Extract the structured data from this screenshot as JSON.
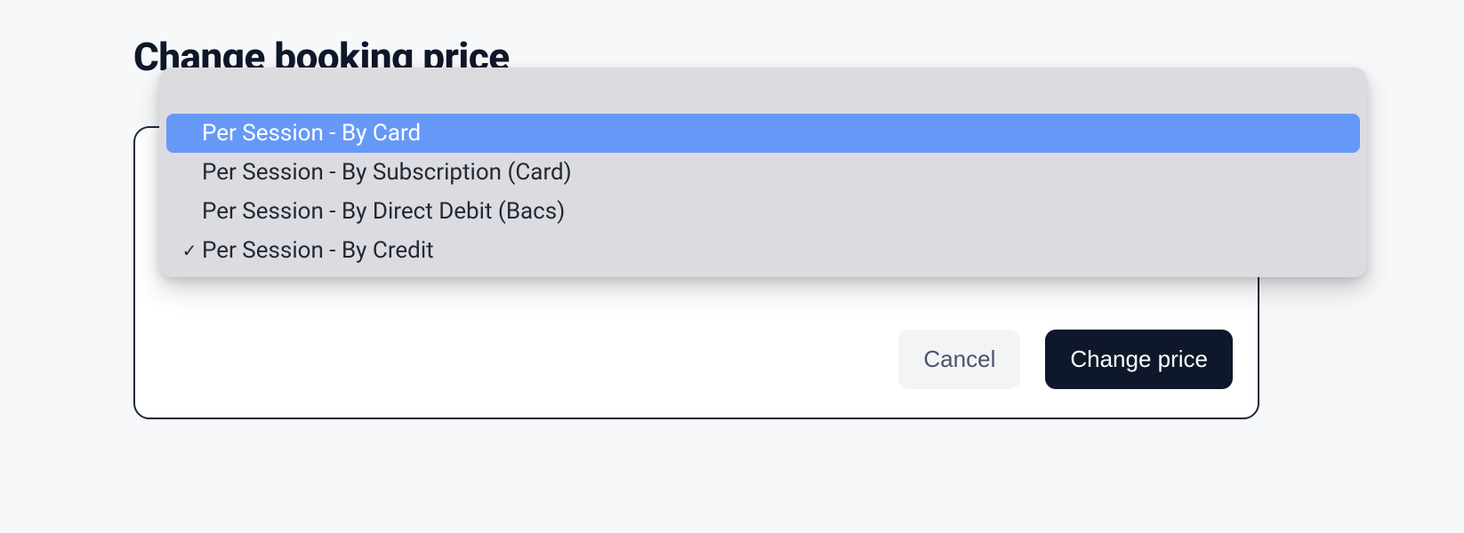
{
  "title": "Change booking price",
  "dropdown": {
    "highlighted_index": 0,
    "selected_index": 3,
    "options": [
      {
        "label": "Per Session - By Card"
      },
      {
        "label": "Per Session - By Subscription (Card)"
      },
      {
        "label": "Per Session - By Direct Debit (Bacs)"
      },
      {
        "label": "Per Session - By Credit"
      }
    ]
  },
  "buttons": {
    "cancel": "Cancel",
    "submit": "Change price"
  },
  "colors": {
    "highlight": "#6698f8",
    "panel": "#dcdbe0",
    "primary_button": "#0f172a",
    "page_bg": "#f6f8fa"
  }
}
